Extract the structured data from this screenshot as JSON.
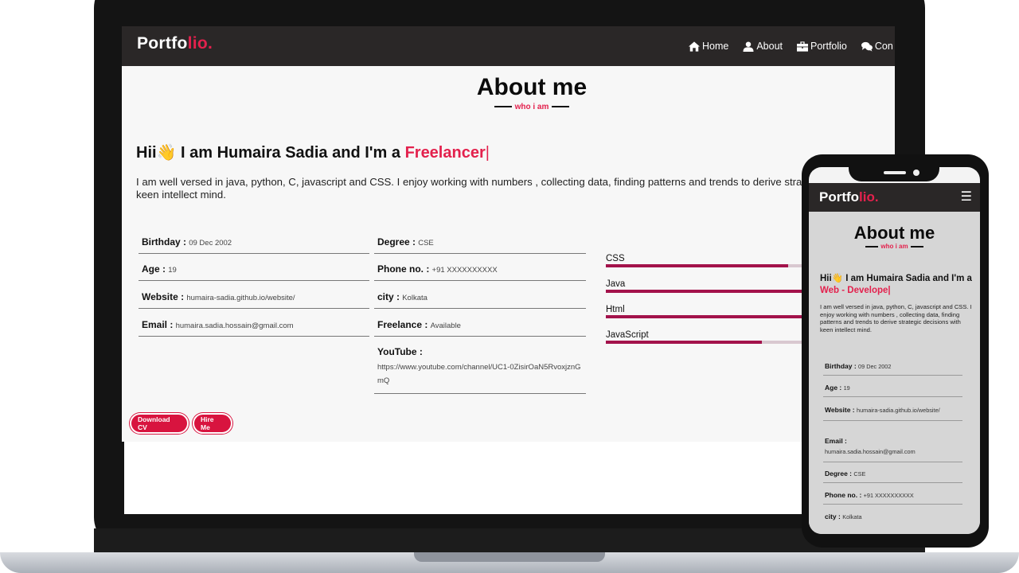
{
  "desktop": {
    "logo": {
      "main": "Portfo",
      "accent": "lio."
    },
    "nav": [
      {
        "label": "Home",
        "icon": "home-icon"
      },
      {
        "label": "About",
        "icon": "user-icon"
      },
      {
        "label": "Portfolio",
        "icon": "briefcase-icon"
      },
      {
        "label": "Con",
        "icon": "comments-icon"
      }
    ],
    "about": {
      "title": "About me",
      "subtitle": "who i am",
      "greeting_prefix": "Hii",
      "greeting_middle": " I am Humaira Sadia and I'm a ",
      "role": "Freelancer",
      "cursor": "|",
      "bio": "I am well versed in java, python, C, javascript and CSS. I enjoy working with numbers , collecting data, finding patterns and trends to derive strategic decisions with keen intellect mind."
    },
    "info_left": [
      {
        "label": "Birthday :",
        "value": "09 Dec 2002"
      },
      {
        "label": "Age :",
        "value": "19"
      },
      {
        "label": "Website :",
        "value": "humaira-sadia.github.io/website/"
      },
      {
        "label": "Email :",
        "value": "humaira.sadia.hossain@gmail.com"
      }
    ],
    "info_right": [
      {
        "label": "Degree :",
        "value": "CSE"
      },
      {
        "label": "Phone no. :",
        "value": "+91 XXXXXXXXXX"
      },
      {
        "label": "city :",
        "value": "Kolkata"
      },
      {
        "label": "Freelance :",
        "value": "Available"
      },
      {
        "label": "YouTube :",
        "value": "https://www.youtube.com/channel/UC1-0ZisirOaN5RvoxjznGmQ"
      }
    ],
    "skills": [
      {
        "name": "CSS",
        "level": 0.62
      },
      {
        "name": "Java",
        "level": 0.75
      },
      {
        "name": "Html",
        "level": 0.85
      },
      {
        "name": "JavaScript",
        "level": 0.53
      }
    ],
    "buttons": {
      "download": "Download CV",
      "hire": "Hire Me"
    }
  },
  "mobile": {
    "logo": {
      "main": "Portfo",
      "accent": "lio."
    },
    "menu_icon": "☰",
    "title": "About me",
    "subtitle": "who i am",
    "greeting_prefix": "Hii",
    "greeting_middle": " I am Humaira Sadia and I'm a",
    "role": "Web - Develope",
    "cursor": "|",
    "bio": "I am well versed in java, python, C, javascript and CSS. I enjoy working with numbers , collecting data, finding patterns and trends to derive strategic decisions with keen intellect mind.",
    "info": [
      {
        "label": "Birthday :",
        "value": "09 Dec 2002"
      },
      {
        "label": "Age :",
        "value": "19"
      },
      {
        "label": "Website :",
        "value": "humaira-sadia.github.io/website/"
      },
      {
        "label": "Email :",
        "value": "humaira.sadia.hossain@gmail.com"
      },
      {
        "label": "Degree :",
        "value": "CSE"
      },
      {
        "label": "Phone no. :",
        "value": "+91 XXXXXXXXXX"
      },
      {
        "label": "city :",
        "value": "Kolkata"
      }
    ]
  },
  "colors": {
    "accent": "#e3214d",
    "nav_bg": "#2a2727",
    "skill_fill": "#a3124b",
    "button": "#d8143f"
  }
}
